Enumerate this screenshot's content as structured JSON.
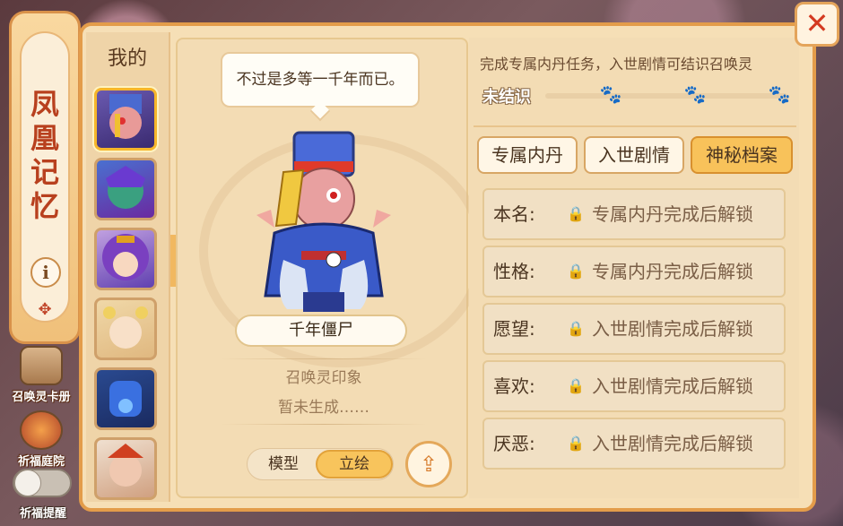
{
  "left": {
    "title": "凤凰记忆",
    "info_label": "i",
    "summon_album_label": "召唤灵卡册",
    "blessing_yard_label": "祈福庭院",
    "blessing_remind_label": "祈福提醒"
  },
  "list": {
    "header": "我的"
  },
  "center": {
    "speech": "不过是多等一千年而已。",
    "name": "千年僵尸",
    "impression_title": "召唤灵印象",
    "impression_status": "暂未生成……",
    "mode_model": "模型",
    "mode_art": "立绘"
  },
  "right": {
    "hint": "完成专属内丹任务，入世剧情可结识召唤灵",
    "status": "未结识",
    "tabs": [
      "专属内丹",
      "入世剧情",
      "神秘档案"
    ],
    "rows": [
      {
        "label": "本名:",
        "text": "专属内丹完成后解锁"
      },
      {
        "label": "性格:",
        "text": "专属内丹完成后解锁"
      },
      {
        "label": "愿望:",
        "text": "入世剧情完成后解锁"
      },
      {
        "label": "喜欢:",
        "text": "入世剧情完成后解锁"
      },
      {
        "label": "厌恶:",
        "text": "入世剧情完成后解锁"
      }
    ]
  },
  "colors": {
    "accent": "#f8c25a",
    "frame": "#e39c4a",
    "title_red": "#b8401e",
    "close_red": "#d43a20"
  }
}
